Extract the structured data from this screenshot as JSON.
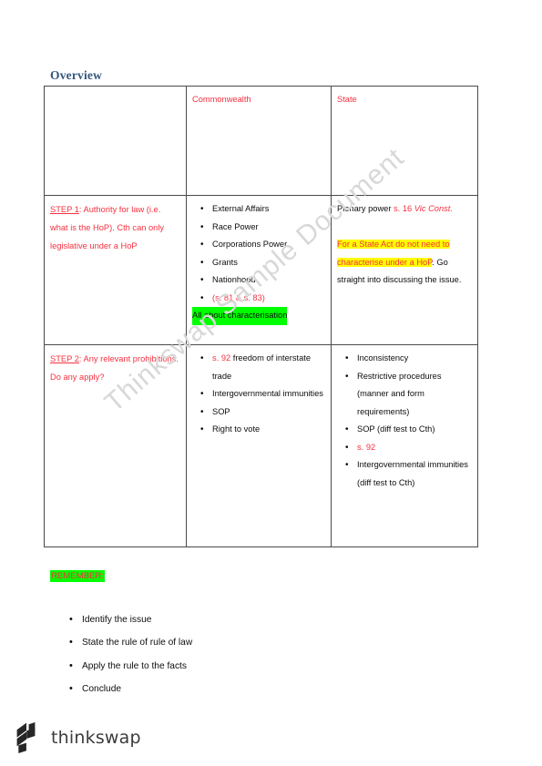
{
  "document": {
    "heading": "Overview",
    "watermark": "Thinkswap Sample Document"
  },
  "colors": {
    "heading_blue": "#35577d",
    "accent_red": "#f5313f",
    "highlight_green": "#00ff00",
    "highlight_yellow": "#ffff00",
    "body_black": "#0d0d0d",
    "table_border": "#4a4a4a"
  },
  "table": {
    "header": {
      "col_blank": "",
      "col_commonwealth": "Commonwealth",
      "col_state": "State"
    },
    "rows": [
      {
        "step_label": "STEP 1",
        "step_sep": ":",
        "step_text": " Authority for law (i.e. what is the HoP). Cth can only legislative under a HoP",
        "commonwealth": {
          "bullets": [
            "External Affairs",
            "Race Power",
            "Corporations Power",
            "Grants",
            "Nationhood"
          ],
          "bullet_red": "(s. 81 & s. 83)",
          "note_highlighted": "All about characterisation"
        },
        "state": {
          "plenary_black": "Plenary power ",
          "plenary_section": "s. 16 ",
          "plenary_italic": "Vic Const.",
          "highlight_red": "For a State Act do not need to characterise under a HoP",
          "after_highlight": ". Go straight into discussing the issue."
        }
      },
      {
        "step_label": "STEP 2",
        "step_sep": ":",
        "step_text": " Any relevant prohibitions. Do any apply?",
        "commonwealth": {
          "bullet1_red": "s. 92",
          "bullet1_black": " freedom of interstate trade",
          "bullets": [
            "Intergovernmental immunities",
            "SOP",
            "Right to vote"
          ]
        },
        "state": {
          "bullets_before": [
            "Inconsistency",
            "Restrictive procedures (manner and form requirements)",
            "SOP (diff test to Cth)"
          ],
          "bullet_red": "s. 92",
          "bullets_after": [
            "Intergovernmental immunities (diff test to Cth)"
          ]
        }
      }
    ]
  },
  "remember": {
    "title": "REMEMBER:",
    "items": [
      "Identify the issue",
      "State the rule of rule of law",
      "Apply the rule to the facts",
      "Conclude"
    ]
  },
  "footer": {
    "brand": "thinkswap"
  }
}
